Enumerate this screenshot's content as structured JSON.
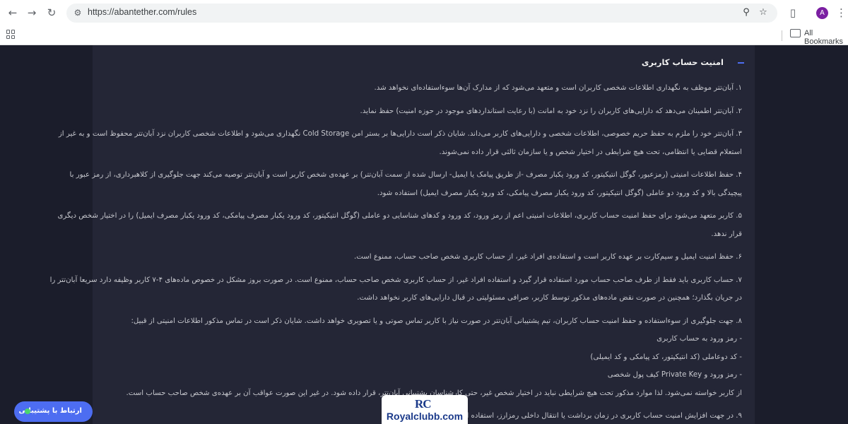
{
  "browser": {
    "url": "https://abantether.com/rules",
    "profile_initial": "A",
    "all_bookmarks_label": "All Bookmarks",
    "icons": [
      "back-icon",
      "forward-icon",
      "reload-icon",
      "site-settings-icon",
      "zoom-icon",
      "star-icon",
      "extensions-icon",
      "menu-icon",
      "apps-icon",
      "folder-icon"
    ]
  },
  "section": {
    "title": "امنیت حساب کاربری",
    "toggle_icon": "minus-icon",
    "accent_color": "#4d6df1"
  },
  "rules": [
    {
      "lines": [
        "۱. آبان‌تتر موظف به نگهداری اطلاعات شخصی کاربران است و متعهد می‌شود که از مدارک آن‌ها سوءاستفاده‌ای نخواهد شد."
      ]
    },
    {
      "lines": [
        "۲. آبان‌تتر اطمینان می‌دهد که دارایی‌های کاربران را نزد خود به امانت (با رعایت استانداردهای موجود در حوزه امنیت) حفظ نماید."
      ]
    },
    {
      "lines": [
        "۳. آبان‌تتر خود را ملزم به حفظ حریم خصوصی، اطلاعات شخصی و دارایی‌های کاربر می‌داند. شایان ذکر است دارایی‌ها بر بستر امن Cold Storage نگهداری می‌شود و اطلاعات شخصی کاربران نزد آبان‌تتر محفوظ است و به غیر از",
        "استعلام قضایی یا انتظامی، تحت هیچ شرایطی در اختیار شخص و یا سازمان ثالثی قرار داده نمی‌شوند."
      ]
    },
    {
      "lines": [
        "۴. حفظ اطلاعات امنیتی (رمزعبور، گوگل انتیکیتور، کد ورود یکبار مصرف -از طریق پیامک یا ایمیل- ارسال شده از سمت آبان‌تتر) بر عهده‌ی شخص کاربر است و آبان‌تتر توصیه می‌کند جهت جلوگیری از کلاهبرداری، از رمز عبور با",
        "پیچیدگی بالا و کد ورود دو عاملی (گوگل انتیکیتور، کد ورود یکبار مصرف پیامکی، کد ورود یکبار مصرف ایمیل) استفاده شود."
      ]
    },
    {
      "lines": [
        "۵. کاربر متعهد می‌شود برای حفظ امنیت حساب کاربری، اطلاعات امنیتی اعم از رمز ورود، کد ورود و کدهای شناسایی دو عاملی (گوگل انتیکیتور، کد ورود یکبار مصرف پیامکی، کد ورود یکبار مصرف ایمیل) را در اختیار شخص دیگری",
        "قرار ندهد."
      ]
    },
    {
      "lines": [
        "۶. حفظ امنیت ایمیل و سیم‌کارت بر عهده کاربر است و استفاده‌ی افراد غیر، از حساب کاربری شخص صاحب حساب، ممنوع است."
      ]
    },
    {
      "lines": [
        "۷. حساب کاربری باید فقط از طرف صاحب حساب مورد استفاده قرار گیرد و استفاده افراد غیر، از حساب کاربری شخص صاحب حساب، ممنوع است. در صورت بروز مشکل در خصوص ماده‌های ۴-۷ کاربر وظیفه دارد سریعا آبان‌تتر را",
        "در جریان بگذارد؛ همچنین در صورت نقض ماده‌های مذکور توسط کاربر، صرافی مسئولیتی در قبال دارایی‌های کاربر نخواهد داشت."
      ]
    },
    {
      "lines": [
        "۸. جهت جلوگیری از سوءاستفاده و حفظ امنیت حساب کاربران، تیم پشتیبانی آبان‌تتر در صورت نیاز با کاربر تماس صوتی و یا تصویری خواهد داشت. شایان ذکر است در تماس مذکور اطلاعات امنیتی از قبیل:"
      ]
    },
    {
      "lines": [
        "- رمز ورود به حساب کاربری"
      ],
      "sub": true
    },
    {
      "lines": [
        "- کد دوعاملی (کد انتیکیتور، کد پیامکی و کد ایمیلی)"
      ],
      "sub": true
    },
    {
      "lines": [
        "- رمز ورود و Private Key کیف پول شخصی"
      ],
      "sub": true
    },
    {
      "lines": [
        "از کاربر خواسته نمی‌شود. لذا موارد مذکور تحت هیچ شرایطی نباید در اختیار شخص غیر، حتی کارشناسان پشتیبانی آبان‌تتر، قرار داده شود. در غیر این صورت عواقب آن بر عهده‌ی شخص صاحب حساب است."
      ]
    },
    {
      "lines": [
        "۹. در جهت افزایش امنیت حساب کاربری در زمان برداشت یا انتقال داخلی رمزارز، استفاده از کد دوعاملی الزامی است."
      ]
    }
  ],
  "support_button": {
    "label": "ارتباط با پشتیبانی",
    "status_color": "#4ad66d"
  },
  "watermark": {
    "logo": "RC",
    "text": "Royalclubb.com"
  }
}
